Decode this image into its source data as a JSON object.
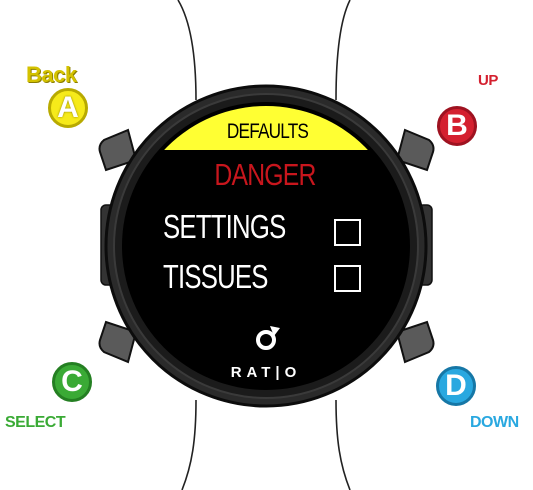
{
  "screen": {
    "header": "DEFAULTS",
    "title": "DANGER",
    "options": [
      {
        "label": "SETTINGS",
        "checked": false
      },
      {
        "label": "TISSUES",
        "checked": false
      }
    ],
    "brand": "RAT|O"
  },
  "buttons": {
    "a": {
      "letter": "A",
      "label": "Back",
      "color": "#f2e600",
      "label_color": "#d4c200"
    },
    "b": {
      "letter": "B",
      "label": "UP",
      "color": "#d4202f",
      "label_color": "#d4202f"
    },
    "c": {
      "letter": "C",
      "label": "SELECT",
      "color": "#3aaa35",
      "label_color": "#3aaa35"
    },
    "d": {
      "letter": "D",
      "label": "DOWN",
      "color": "#29a8e0",
      "label_color": "#29a8e0"
    }
  },
  "colors": {
    "header_bar": "#ffff33",
    "danger_text": "#c8161d",
    "bezel": "#1b1b1b",
    "screen_bg": "#000000"
  }
}
